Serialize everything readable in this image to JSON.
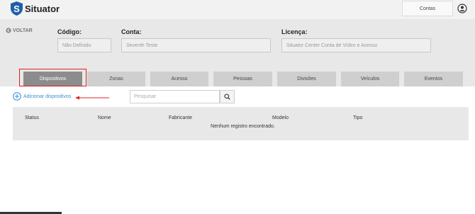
{
  "app": {
    "name": "Situator"
  },
  "header": {
    "contas_label": "Contas"
  },
  "nav": {
    "back_label": "VOLTAR"
  },
  "fields": {
    "codigo": {
      "label": "Código:",
      "value": "Não Definido"
    },
    "conta": {
      "label": "Conta:",
      "value": "Seventh Teste"
    },
    "licenca": {
      "label": "Licença:",
      "value": "Situator Center Conta de Vídeo e Acesso"
    }
  },
  "tabs": [
    {
      "label": "Dispositivos",
      "active": true
    },
    {
      "label": "Zonas",
      "active": false
    },
    {
      "label": "Acesso",
      "active": false
    },
    {
      "label": "Pessoas",
      "active": false
    },
    {
      "label": "Divisões",
      "active": false
    },
    {
      "label": "Veículos",
      "active": false
    },
    {
      "label": "Eventos",
      "active": false
    }
  ],
  "actions": {
    "add_device_label": "Adicionar dispositivos",
    "search_placeholder": "Pesquisar"
  },
  "table": {
    "columns": [
      "Status",
      "Nome",
      "Fabricante",
      "Modelo",
      "Tipo"
    ],
    "empty_message": "Nenhum registro encontrado."
  },
  "colors": {
    "accent": "#3a8dd6",
    "highlight": "#e21f1f",
    "active_tab": "#8c8c8c",
    "logo_shield": "#1f5fa8"
  }
}
